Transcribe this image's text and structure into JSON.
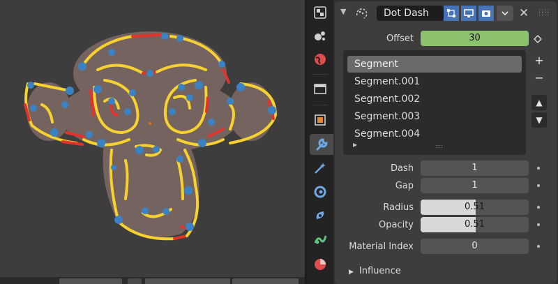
{
  "viewport": {
    "scene": "Suzanne monkey head with dot-dash grease pencil stroke",
    "stroke_colors": {
      "yellow": "#f6d12f",
      "blue": "#3b82c4",
      "red": "#e0332c",
      "fill": "#7f6a66"
    }
  },
  "properties_tabs": [
    {
      "name": "texture-tab",
      "icon": "texture-icon"
    },
    {
      "name": "particles-tab",
      "icon": "particles-icon"
    },
    {
      "name": "world-tab",
      "icon": "world-icon"
    },
    {
      "name": "collection-tab",
      "icon": "collection-icon"
    },
    {
      "name": "object-tab",
      "icon": "object-icon"
    },
    {
      "name": "modifiers-tab",
      "icon": "wrench-icon",
      "active": true
    },
    {
      "name": "effects-tab",
      "icon": "shader-fx-icon"
    },
    {
      "name": "physics-tab",
      "icon": "physics-icon"
    },
    {
      "name": "constraints-tab",
      "icon": "constraint-icon"
    },
    {
      "name": "data-tab",
      "icon": "greasepencil-data-icon"
    },
    {
      "name": "material-tab",
      "icon": "material-icon"
    }
  ],
  "modifier": {
    "name": "Dot Dash",
    "offset_label": "Offset",
    "offset_value": "30",
    "segments": [
      "Segment",
      "Segment.001",
      "Segment.002",
      "Segment.003",
      "Segment.004"
    ],
    "selected_segment": 0,
    "add_label": "+",
    "remove_label": "−",
    "move_up_label": "▲",
    "move_down_label": "▼",
    "dash_label": "Dash",
    "dash_value": "1",
    "gap_label": "Gap",
    "gap_value": "1",
    "radius_label": "Radius",
    "radius_value": "0.51",
    "radius_fraction": 0.51,
    "opacity_label": "Opacity",
    "opacity_value": "0.51",
    "opacity_fraction": 0.51,
    "material_index_label": "Material Index",
    "material_index_value": "0",
    "influence_label": "Influence"
  }
}
